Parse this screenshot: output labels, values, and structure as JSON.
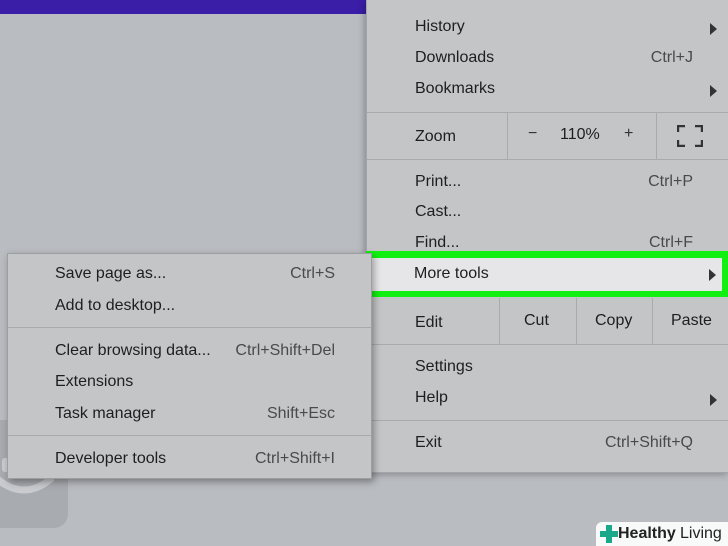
{
  "menu": {
    "items": [
      {
        "label": "History",
        "shortcut": ""
      },
      {
        "label": "Downloads",
        "shortcut": "Ctrl+J"
      },
      {
        "label": "Bookmarks",
        "shortcut": ""
      }
    ],
    "zoom": {
      "label": "Zoom",
      "minus": "−",
      "value": "110%",
      "plus": "+"
    },
    "print": {
      "label": "Print...",
      "shortcut": "Ctrl+P"
    },
    "cast": {
      "label": "Cast..."
    },
    "find": {
      "label": "Find...",
      "shortcut": "Ctrl+F"
    },
    "more_tools": {
      "label": "More tools"
    },
    "edit": {
      "label": "Edit",
      "cut": "Cut",
      "copy": "Copy",
      "paste": "Paste"
    },
    "settings": {
      "label": "Settings"
    },
    "help": {
      "label": "Help"
    },
    "exit": {
      "label": "Exit",
      "shortcut": "Ctrl+Shift+Q"
    }
  },
  "submenu": {
    "items": [
      {
        "label": "Save page as...",
        "shortcut": "Ctrl+S"
      },
      {
        "label": "Add to desktop...",
        "shortcut": ""
      },
      {
        "label": "Clear browsing data...",
        "shortcut": "Ctrl+Shift+Del"
      },
      {
        "label": "Extensions",
        "shortcut": ""
      },
      {
        "label": "Task manager",
        "shortcut": "Shift+Esc"
      },
      {
        "label": "Developer tools",
        "shortcut": "Ctrl+Shift+I"
      }
    ]
  },
  "brand": {
    "part1": "Healthy",
    "part2": "Living"
  },
  "colors": {
    "highlight": "#12f012",
    "topbar": "#3a1ea8",
    "menu_bg": "#c4c5c7"
  }
}
